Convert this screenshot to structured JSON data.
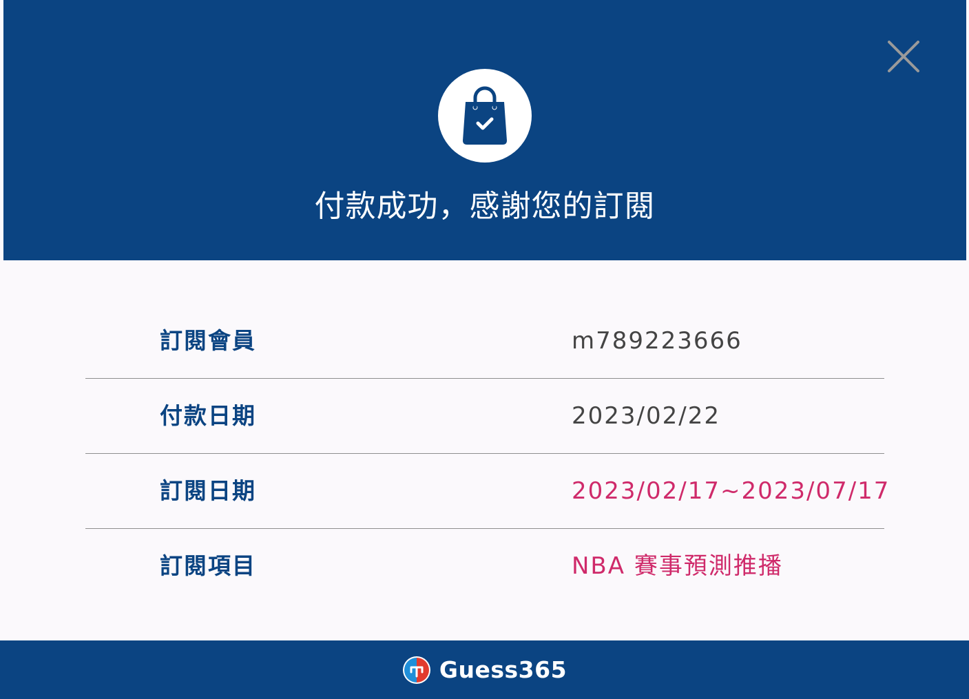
{
  "header": {
    "title": "付款成功，感謝您的訂閱",
    "background_color": "#0b4482",
    "icon": "shopping-bag-check-icon",
    "close_icon": "close-icon"
  },
  "details": [
    {
      "label": "訂閱會員",
      "value": "m789223666",
      "highlight": false
    },
    {
      "label": "付款日期",
      "value": "2023/02/22",
      "highlight": false
    },
    {
      "label": "訂閱日期",
      "value": "2023/02/17~2023/07/17",
      "highlight": true
    },
    {
      "label": "訂閱項目",
      "value": "NBA 賽事預測推播",
      "highlight": true
    }
  ],
  "footer": {
    "brand": "Guess365",
    "logo_icon": "guess365-logo-icon"
  },
  "colors": {
    "primary": "#0b4482",
    "highlight": "#cf2a6a",
    "value_text": "#444444",
    "close_icon": "#9a9a9a"
  }
}
